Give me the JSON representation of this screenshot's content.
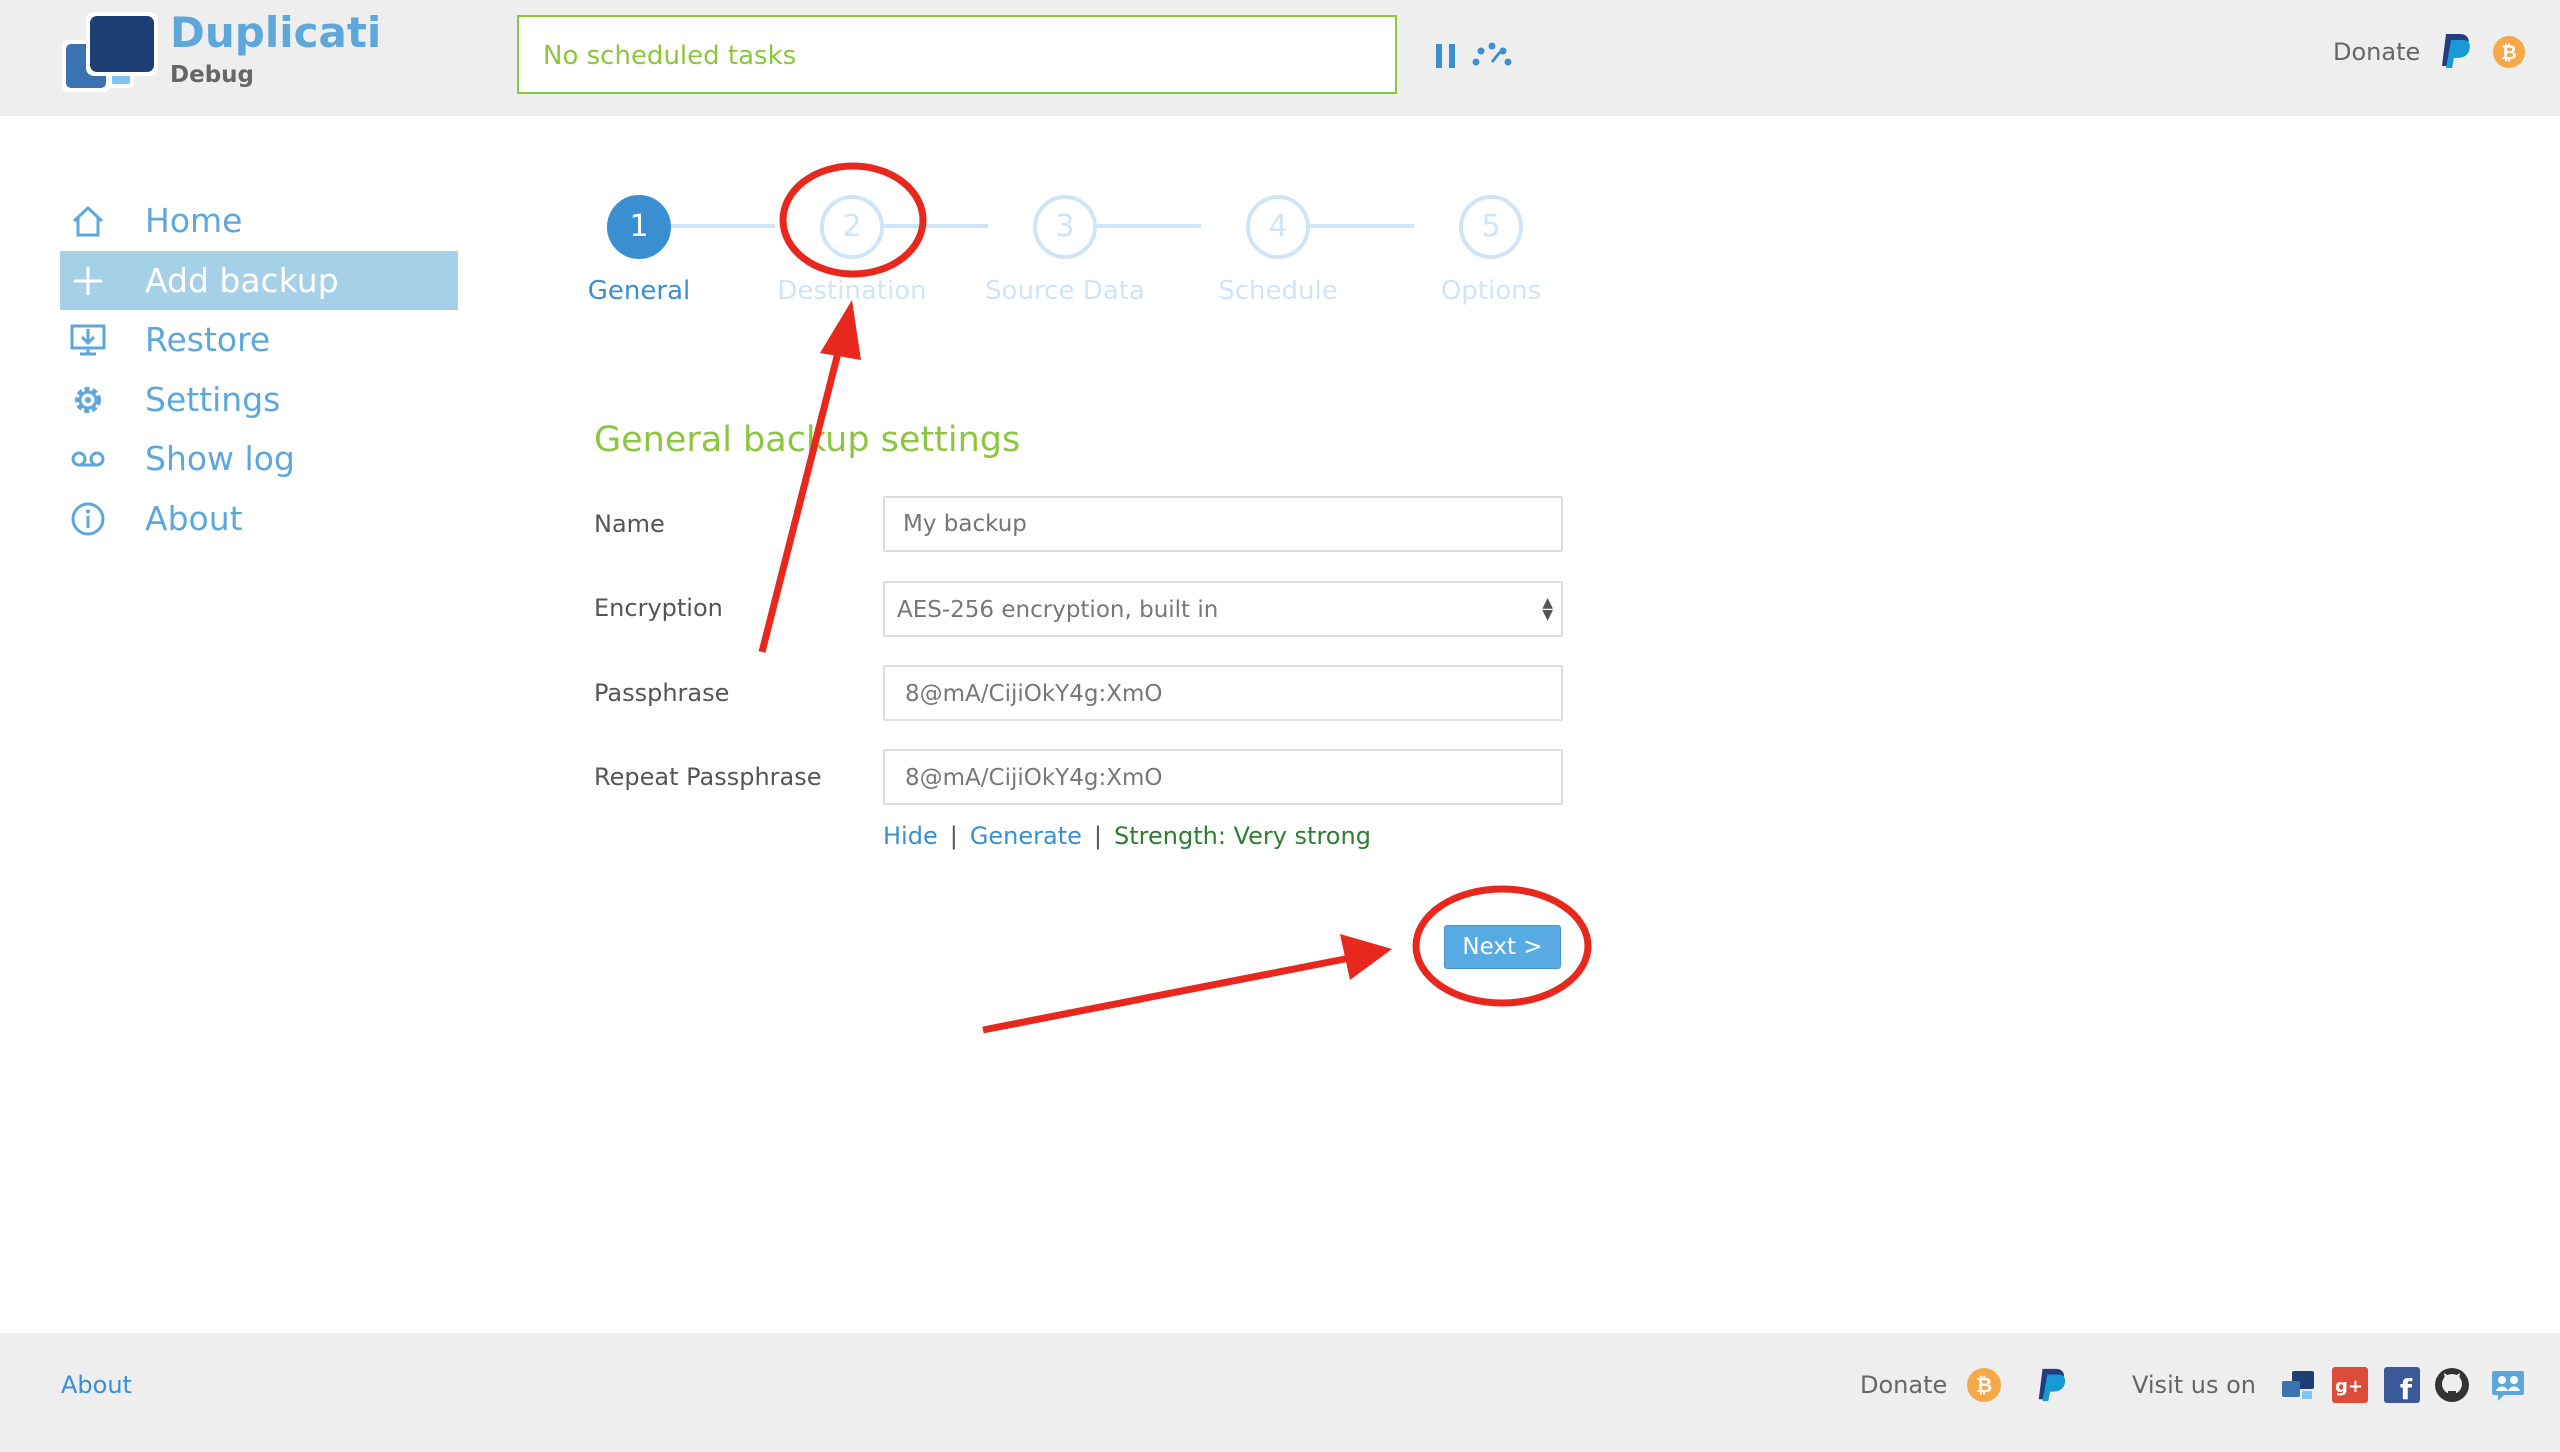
{
  "app": {
    "name": "Duplicati",
    "edition": "Debug"
  },
  "header": {
    "task_status": "No scheduled tasks",
    "donate_label": "Donate"
  },
  "sidebar": {
    "items": [
      {
        "label": "Home",
        "icon": "home-icon"
      },
      {
        "label": "Add backup",
        "icon": "plus-icon",
        "active": true
      },
      {
        "label": "Restore",
        "icon": "restore-icon"
      },
      {
        "label": "Settings",
        "icon": "gear-icon"
      },
      {
        "label": "Show log",
        "icon": "log-icon"
      },
      {
        "label": "About",
        "icon": "info-icon"
      }
    ]
  },
  "stepper": {
    "current": 1,
    "steps": [
      {
        "number": "1",
        "label": "General"
      },
      {
        "number": "2",
        "label": "Destination"
      },
      {
        "number": "3",
        "label": "Source Data"
      },
      {
        "number": "4",
        "label": "Schedule"
      },
      {
        "number": "5",
        "label": "Options"
      }
    ]
  },
  "form": {
    "title": "General backup settings",
    "name_label": "Name",
    "name_placeholder": "My backup",
    "encryption_label": "Encryption",
    "encryption_value": "AES-256 encryption, built in",
    "passphrase_label": "Passphrase",
    "passphrase_value": "8@mA/CijiOkY4g:XmO",
    "repeat_label": "Repeat Passphrase",
    "repeat_value": "8@mA/CijiOkY4g:XmO",
    "hide_link": "Hide",
    "generate_link": "Generate",
    "separator": "|",
    "strength": "Strength: Very strong",
    "next_button": "Next >"
  },
  "footer": {
    "about": "About",
    "donate": "Donate",
    "visit": "Visit us on",
    "social_icons": [
      "forum-icon",
      "google-plus-icon",
      "facebook-icon",
      "github-icon",
      "mailing-list-icon"
    ]
  },
  "colors": {
    "accent": "#3a8fd0",
    "brand": "#5ea7db",
    "green": "#8cc63f",
    "annotation": "#e8271d",
    "bitcoin": "#f7a848"
  }
}
